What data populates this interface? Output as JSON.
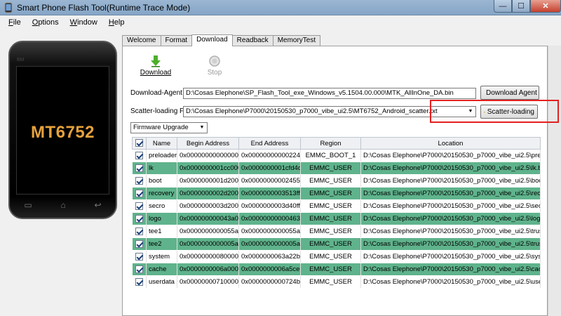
{
  "window": {
    "title": "Smart Phone Flash Tool(Runtime Trace Mode)",
    "controls": {
      "minimize": "—",
      "maximize": "☐",
      "close": "✕"
    }
  },
  "menu": [
    {
      "label": "File",
      "mnemonic": "F",
      "rest": "ile"
    },
    {
      "label": "Options",
      "mnemonic": "O",
      "rest": "ptions"
    },
    {
      "label": "Window",
      "mnemonic": "W",
      "rest": "indow"
    },
    {
      "label": "Help",
      "mnemonic": "H",
      "rest": "elp"
    }
  ],
  "phone": {
    "chip": "MT6752",
    "brand": "BM"
  },
  "tabs": [
    "Welcome",
    "Format",
    "Download",
    "Readback",
    "MemoryTest"
  ],
  "active_tab": "Download",
  "toolbar": {
    "download_label": "Download",
    "stop_label": "Stop"
  },
  "download_agent": {
    "label": "Download-Agent",
    "value": "D:\\Cosas Elephone\\SP_Flash_Tool_exe_Windows_v5.1504.00.000\\MTK_AllInOne_DA.bin",
    "button": "Download Agent"
  },
  "scatter": {
    "label": "Scatter-loading File",
    "value": "D:\\Cosas Elephone\\P7000\\20150530_p7000_vibe_ui2.5\\MT6752_Android_scatter.txt",
    "button": "Scatter-loading"
  },
  "mode": {
    "selected": "Firmware Upgrade"
  },
  "table": {
    "headers": [
      "Name",
      "Begin Address",
      "End Address",
      "Region",
      "Location"
    ],
    "rows": [
      {
        "name": "preloader",
        "begin": "0x0000000000000000",
        "end": "0x00000000000224e3",
        "region": "EMMC_BOOT_1",
        "location": "D:\\Cosas Elephone\\P7000\\20150530_p7000_vibe_ui2.5\\prelo..."
      },
      {
        "name": "lk",
        "begin": "0x0000000001cc0000",
        "end": "0x0000000001cfd4df",
        "region": "EMMC_USER",
        "location": "D:\\Cosas Elephone\\P7000\\20150530_p7000_vibe_ui2.5\\lk.bin"
      },
      {
        "name": "boot",
        "begin": "0x0000000001d20000",
        "end": "0x00000000002455fff",
        "region": "EMMC_USER",
        "location": "D:\\Cosas Elephone\\P7000\\20150530_p7000_vibe_ui2.5\\boot...."
      },
      {
        "name": "recovery",
        "begin": "0x0000000002d20000",
        "end": "0x0000000003513fff",
        "region": "EMMC_USER",
        "location": "D:\\Cosas Elephone\\P7000\\20150530_p7000_vibe_ui2.5\\recov..."
      },
      {
        "name": "secro",
        "begin": "0x0000000003d20000",
        "end": "0x0000000003d40fff",
        "region": "EMMC_USER",
        "location": "D:\\Cosas Elephone\\P7000\\20150530_p7000_vibe_ui2.5\\secro..."
      },
      {
        "name": "logo",
        "begin": "0x000000000043a0000",
        "end": "0x00000000000463f1d1",
        "region": "EMMC_USER",
        "location": "D:\\Cosas Elephone\\P7000\\20150530_p7000_vibe_ui2.5\\logo...."
      },
      {
        "name": "tee1",
        "begin": "0x0000000000055a0000",
        "end": "0x0000000000055aa5ff",
        "region": "EMMC_USER",
        "location": "D:\\Cosas Elephone\\P7000\\20150530_p7000_vibe_ui2.5\\trustz..."
      },
      {
        "name": "tee2",
        "begin": "0x0000000000005aa0000",
        "end": "0x0000000000005aaa5ff",
        "region": "EMMC_USER",
        "location": "D:\\Cosas Elephone\\P7000\\20150530_p7000_vibe_ui2.5\\trustz..."
      },
      {
        "name": "system",
        "begin": "0x0000000008000000",
        "end": "0x0000000063a22b03",
        "region": "EMMC_USER",
        "location": "D:\\Cosas Elephone\\P7000\\20150530_p7000_vibe_ui2.5\\syste..."
      },
      {
        "name": "cache",
        "begin": "0x0000000006a000000",
        "end": "0x0000000006a5ce093",
        "region": "EMMC_USER",
        "location": "D:\\Cosas Elephone\\P7000\\20150530_p7000_vibe_ui2.5\\cache..."
      },
      {
        "name": "userdata",
        "begin": "0x0000000071000000",
        "end": "0x0000000000724ba22b",
        "region": "EMMC_USER",
        "location": "D:\\Cosas Elephone\\P7000\\20150530_p7000_vibe_ui2.5\\userd..."
      }
    ]
  },
  "colors": {
    "row_highlight": "#5fb38c",
    "annotation": "#e52020",
    "chip_text": "#e6a23c"
  }
}
